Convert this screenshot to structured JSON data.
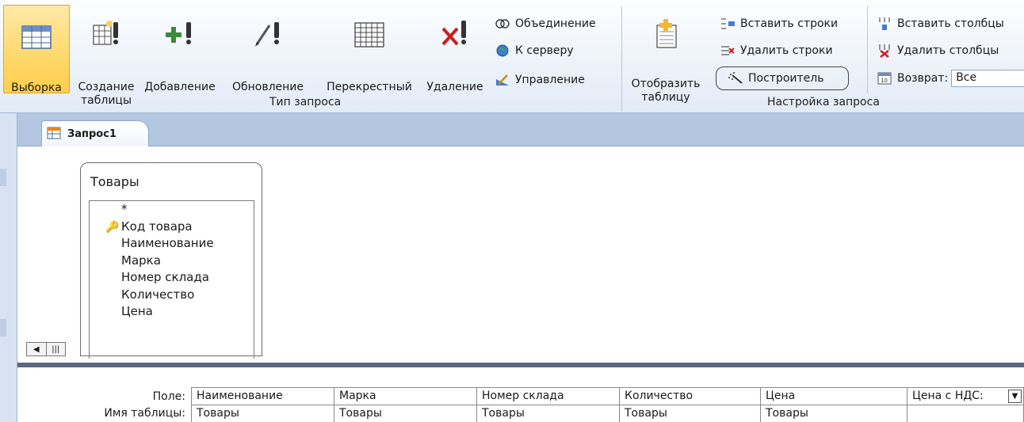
{
  "ribbon": {
    "query_type_buttons": [
      {
        "label1": "Выборка",
        "label2": "",
        "icon": "select-query-icon",
        "selected": true
      },
      {
        "label1": "Создание",
        "label2": "таблицы",
        "icon": "make-table-icon"
      },
      {
        "label1": "Добавление",
        "label2": "",
        "icon": "append-query-icon"
      },
      {
        "label1": "Обновление",
        "label2": "",
        "icon": "update-query-icon"
      },
      {
        "label1": "Перекрестный",
        "label2": "",
        "icon": "crosstab-query-icon"
      },
      {
        "label1": "Удаление",
        "label2": "",
        "icon": "delete-query-icon"
      }
    ],
    "query_type_small": [
      "Объединение",
      "К серверу",
      "Управление"
    ],
    "query_type_group_label": "Тип запроса",
    "show_table": {
      "label1": "Отобразить",
      "label2": "таблицу"
    },
    "setup_small": [
      "Вставить строки",
      "Удалить строки",
      "Построитель",
      "Вставить столбцы",
      "Удалить столбцы"
    ],
    "return_label": "Возврат:",
    "return_value": "Все",
    "setup_group_label": "Настройка запроса"
  },
  "document": {
    "tab_label": "Запрос1",
    "table_name": "Товары",
    "fields": [
      "*",
      "Код товара",
      "Наименование",
      "Марка",
      "Номер склада",
      "Количество",
      "Цена"
    ],
    "primary_key_field": "Код товара"
  },
  "grid": {
    "row_labels": [
      "Поле:",
      "Имя таблицы:"
    ],
    "columns": [
      {
        "field": "Наименование",
        "table": "Товары"
      },
      {
        "field": "Марка",
        "table": "Товары"
      },
      {
        "field": "Номер склада",
        "table": "Товары"
      },
      {
        "field": "Количество",
        "table": "Товары"
      },
      {
        "field": "Цена",
        "table": "Товары"
      },
      {
        "field": "Цена с НДС:",
        "table": ""
      }
    ]
  },
  "colors": {
    "selected_button": "#ffd86a",
    "tab_bar": "#b3c7e1",
    "ribbon_bg": "#eef3fa"
  }
}
